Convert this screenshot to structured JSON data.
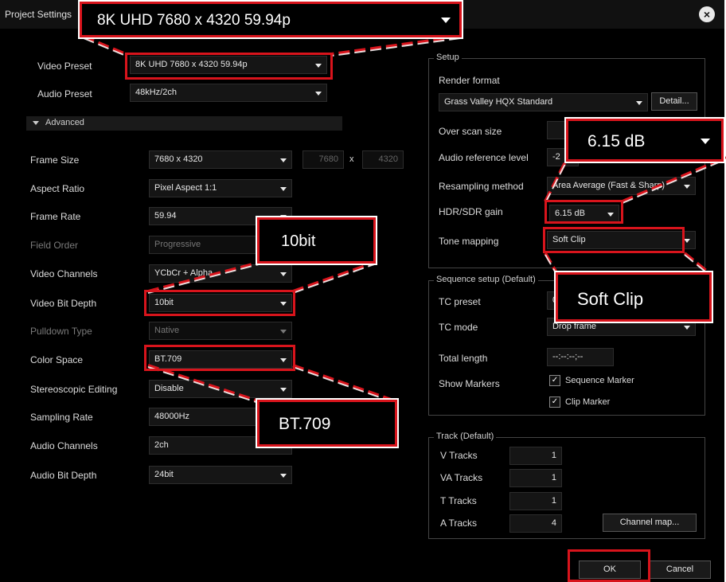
{
  "title": "Project Settings",
  "left": {
    "video_preset_label": "Video Preset",
    "video_preset_value": "8K UHD 7680 x 4320 59.94p",
    "audio_preset_label": "Audio Preset",
    "audio_preset_value": "48kHz/2ch",
    "advanced_label": "Advanced",
    "frame_size_label": "Frame Size",
    "frame_size_value": "7680 x 4320",
    "frame_width": "7680",
    "frame_x": "x",
    "frame_height": "4320",
    "aspect_ratio_label": "Aspect Ratio",
    "aspect_ratio_value": "Pixel Aspect 1:1",
    "frame_rate_label": "Frame Rate",
    "frame_rate_value": "59.94",
    "field_order_label": "Field Order",
    "field_order_value": "Progressive",
    "video_channels_label": "Video Channels",
    "video_channels_value": "YCbCr + Alpha",
    "video_bit_depth_label": "Video Bit Depth",
    "video_bit_depth_value": "10bit",
    "pulldown_type_label": "Pulldown Type",
    "pulldown_type_value": "Native",
    "color_space_label": "Color Space",
    "color_space_value": "BT.709",
    "stereoscopic_label": "Stereoscopic Editing",
    "stereoscopic_value": "Disable",
    "sampling_rate_label": "Sampling Rate",
    "sampling_rate_value": "48000Hz",
    "audio_channels_label": "Audio Channels",
    "audio_channels_value": "2ch",
    "audio_bit_depth_label": "Audio Bit Depth",
    "audio_bit_depth_value": "24bit"
  },
  "setup": {
    "title": "Setup",
    "render_format_label": "Render format",
    "render_format_value": "Grass Valley HQX Standard",
    "detail_button": "Detail...",
    "over_scan_label": "Over scan size",
    "audio_ref_label": "Audio reference level",
    "audio_ref_value": "-2",
    "resampling_label": "Resampling method",
    "resampling_value": "Area Average (Fast & Sharp)",
    "hdr_gain_label": "HDR/SDR gain",
    "hdr_gain_value": "6.15 dB",
    "tone_mapping_label": "Tone mapping",
    "tone_mapping_value": "Soft Clip"
  },
  "sequence": {
    "title": "Sequence setup (Default)",
    "tc_preset_label": "TC preset",
    "tc_preset_value": "0",
    "tc_mode_label": "TC mode",
    "tc_mode_value": "Drop frame",
    "total_length_label": "Total length",
    "total_length_value": "--:--:--;--",
    "show_markers_label": "Show Markers",
    "sequence_marker_label": "Sequence Marker",
    "clip_marker_label": "Clip Marker",
    "check_mark": "✓"
  },
  "track": {
    "title": "Track (Default)",
    "v_label": "V Tracks",
    "v_value": "1",
    "va_label": "VA Tracks",
    "va_value": "1",
    "t_label": "T Tracks",
    "t_value": "1",
    "a_label": "A Tracks",
    "a_value": "4",
    "channel_map_button": "Channel map..."
  },
  "buttons": {
    "ok": "OK",
    "cancel": "Cancel"
  },
  "callouts": {
    "preset": "8K UHD 7680 x 4320 59.94p",
    "bit_depth": "10bit",
    "color_space": "BT.709",
    "hdr_gain": "6.15 dB",
    "tone_mapping": "Soft Clip"
  },
  "colors": {
    "highlight": "#d8141c",
    "background": "#000000"
  }
}
